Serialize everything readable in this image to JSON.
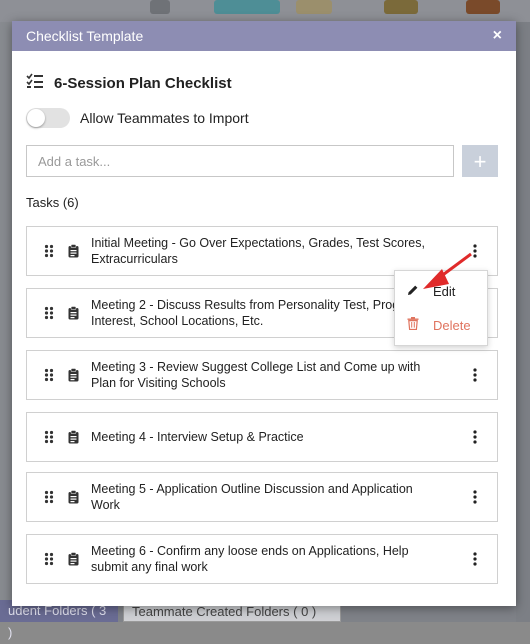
{
  "modal": {
    "title": "Checklist Template",
    "close_label": "×"
  },
  "checklist": {
    "name": "6-Session Plan Checklist",
    "allow_import_label": "Allow Teammates to Import",
    "allow_import_on": false,
    "add_task_placeholder": "Add a task...",
    "add_button_label": "+",
    "tasks_label": "Tasks (6)"
  },
  "tasks": [
    {
      "text": "Initial Meeting - Go Over Expectations, Grades, Test Scores, Extracurriculars"
    },
    {
      "text": "Meeting 2 - Discuss Results from Personality Test, Progr Interest, School Locations, Etc."
    },
    {
      "text": "Meeting 3 - Review Suggest College List and Come up with Plan for Visiting Schools"
    },
    {
      "text": "Meeting 4 - Interview Setup & Practice"
    },
    {
      "text": "Meeting 5 - Application Outline Discussion and Application Work"
    },
    {
      "text": "Meeting 6 - Confirm any loose ends on Applications, Help submit any final work"
    }
  ],
  "context_menu": {
    "edit_label": "Edit",
    "delete_label": "Delete"
  },
  "background": {
    "tab_student_folders": "udent Folders ( 3 )",
    "tab_teammate_folders": "Teammate Created Folders ( 0 )"
  },
  "colors": {
    "header": "#8d8db3",
    "delete": "#e0745f",
    "arrow": "#e02a2a"
  },
  "icons": {
    "list": "checklist-icon",
    "drag": "drag-handle-icon",
    "clipboard": "clipboard-icon",
    "kebab": "kebab-icon",
    "edit": "pencil-icon",
    "delete": "trash-icon",
    "close": "close-icon"
  }
}
